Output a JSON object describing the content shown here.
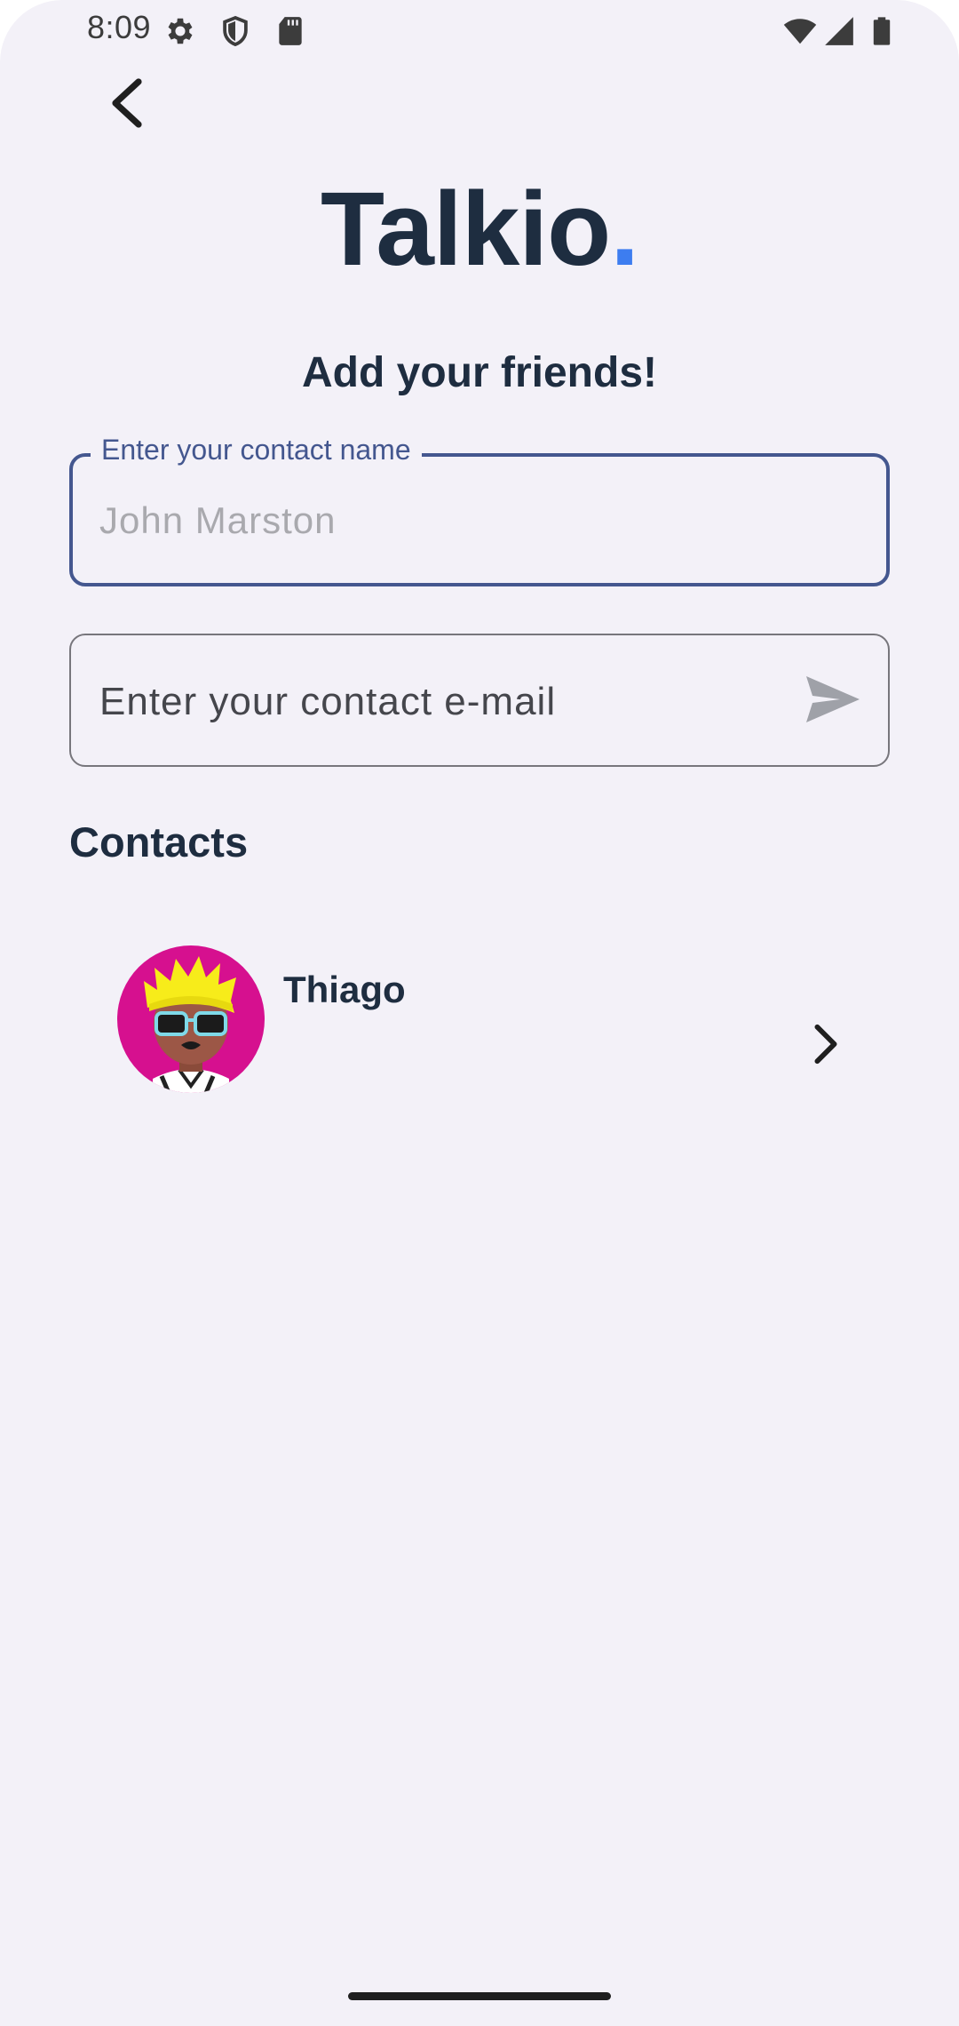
{
  "status_bar": {
    "time": "8:09",
    "left_icons": [
      "settings-icon",
      "shield-icon",
      "sd-card-icon"
    ],
    "right_icons": [
      "wifi-icon",
      "cell-signal-icon",
      "battery-icon"
    ]
  },
  "header": {
    "logo_text": "Talkio",
    "logo_dot": ".",
    "logo_dot_color": "#3d7df0",
    "subtitle": "Add your friends!"
  },
  "form": {
    "name_label": "Enter your contact name",
    "name_placeholder": "John Marston",
    "email_placeholder": "Enter your contact e-mail",
    "focus_color": "#44578f"
  },
  "contacts": {
    "title": "Contacts",
    "items": [
      {
        "name": "Thiago"
      }
    ]
  }
}
